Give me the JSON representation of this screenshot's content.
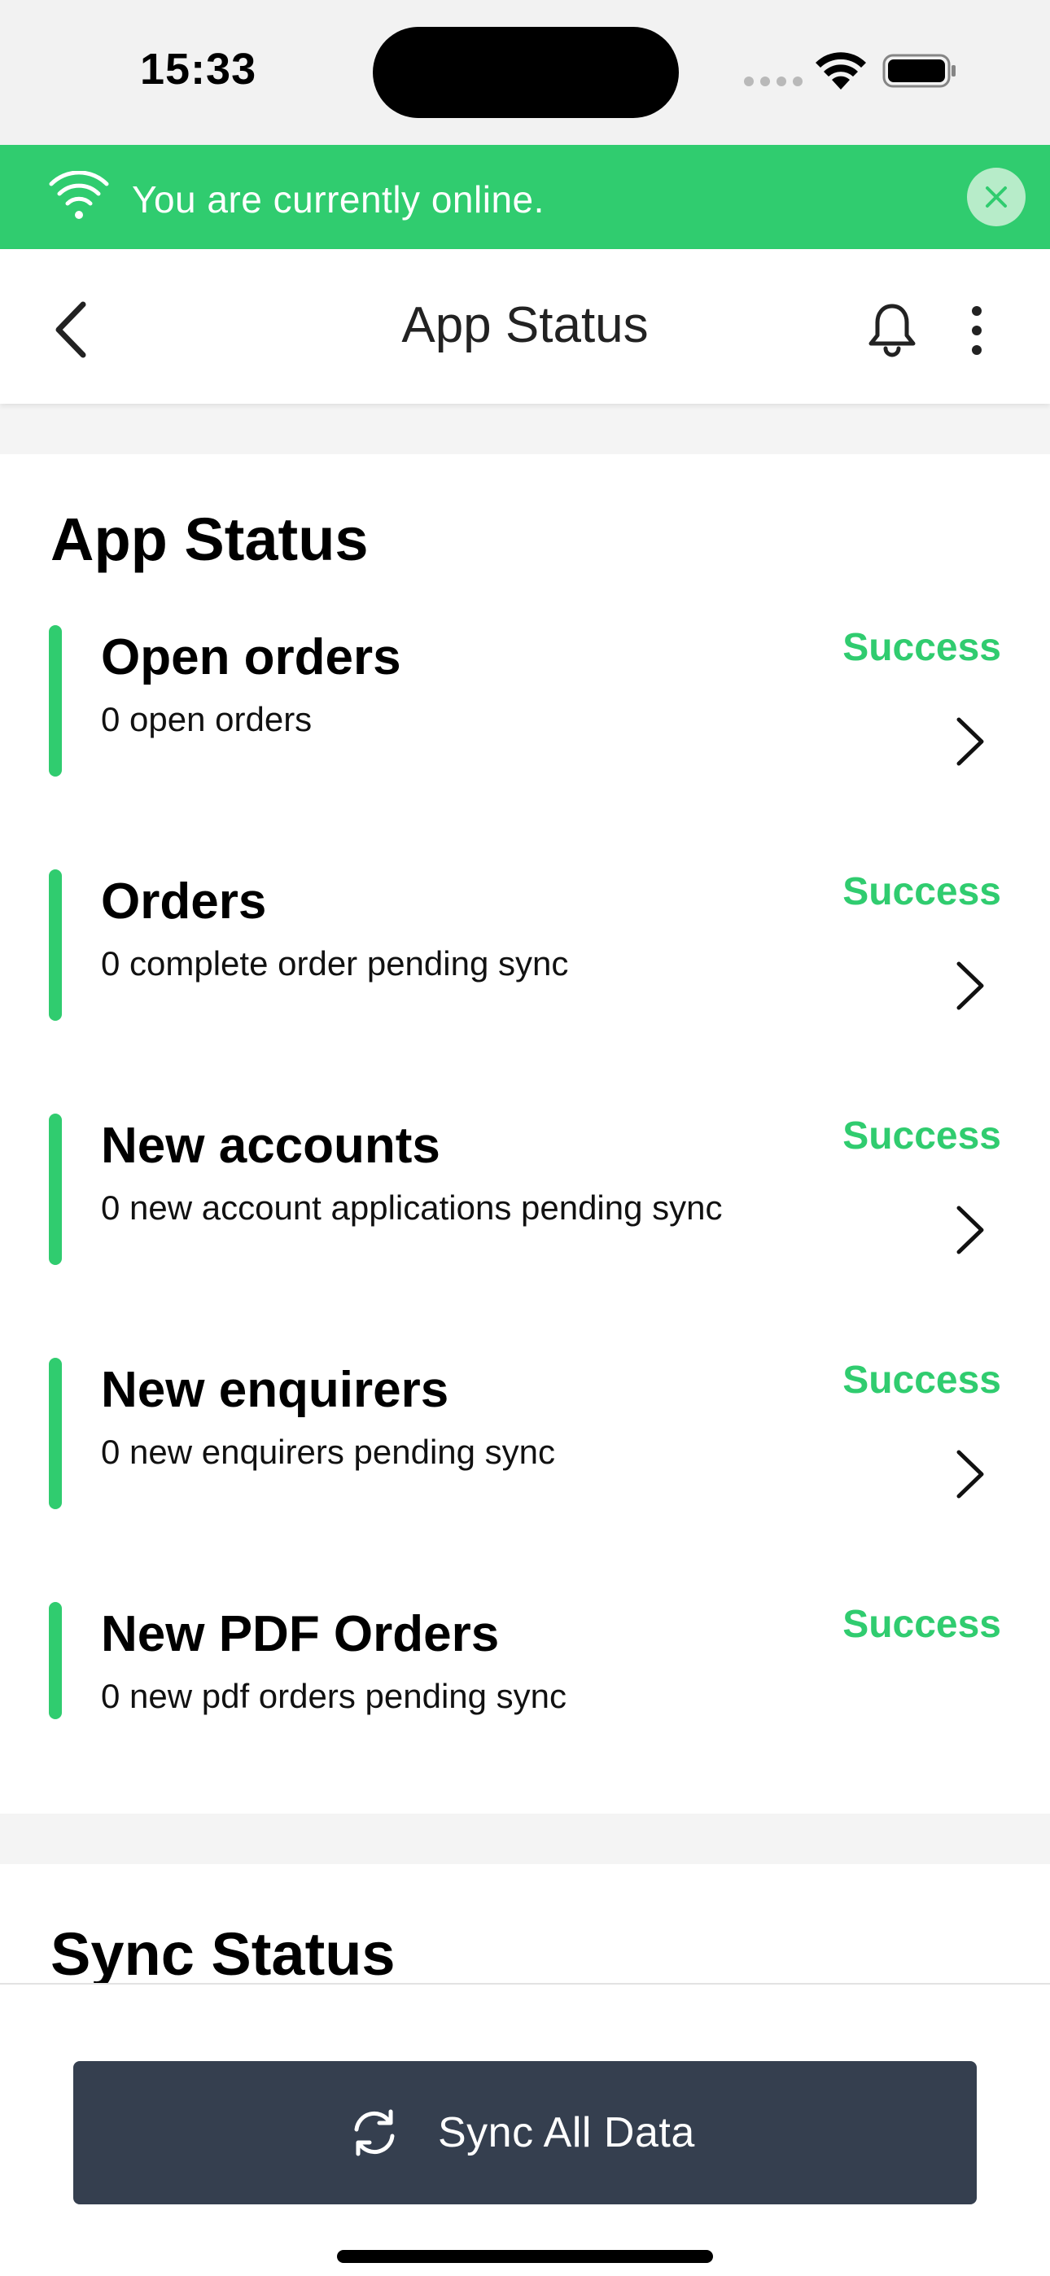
{
  "status_bar": {
    "time": "15:33"
  },
  "banner": {
    "text": "You are currently online.",
    "color": "#30cc6f"
  },
  "header": {
    "title": "App Status"
  },
  "app_status": {
    "title": "App Status",
    "items": [
      {
        "name": "Open orders",
        "description": "0 open orders",
        "status": "Success",
        "has_chevron": true
      },
      {
        "name": "Orders",
        "description": "0 complete order pending sync",
        "status": "Success",
        "has_chevron": true
      },
      {
        "name": "New accounts",
        "description": "0 new account applications pending sync",
        "status": "Success",
        "has_chevron": true
      },
      {
        "name": "New enquirers",
        "description": "0 new enquirers pending sync",
        "status": "Success",
        "has_chevron": true
      },
      {
        "name": "New PDF Orders",
        "description": "0 new pdf orders pending sync",
        "status": "Success",
        "has_chevron": false
      }
    ]
  },
  "sync_status": {
    "title": "Sync Status"
  },
  "sync_button": {
    "label": "Sync All Data"
  },
  "colors": {
    "success": "#30cc6f",
    "button": "#353f4f"
  }
}
